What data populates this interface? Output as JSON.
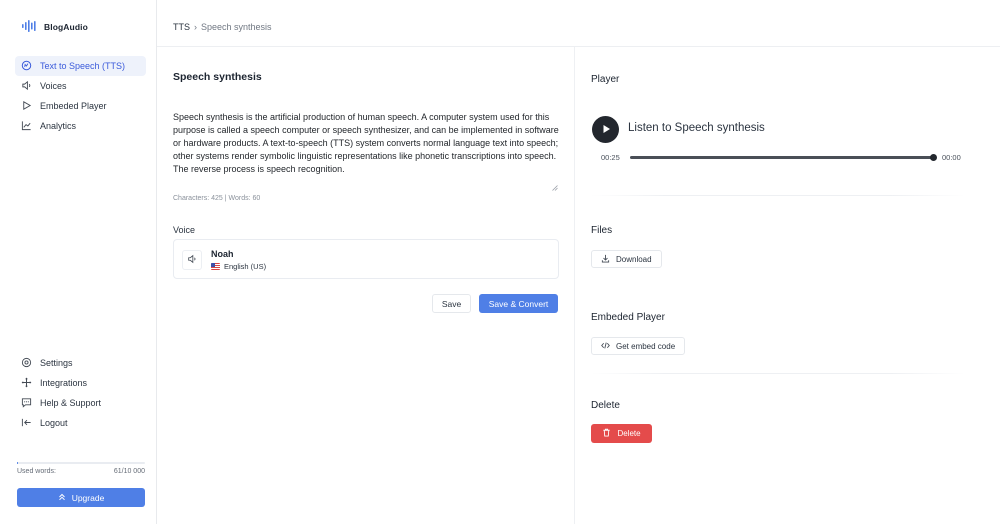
{
  "brand": {
    "name": "BlogAudio"
  },
  "sidebar": {
    "nav": [
      {
        "label": "Text to Speech (TTS)",
        "icon": "tts-icon",
        "active": true
      },
      {
        "label": "Voices",
        "icon": "speaker-icon"
      },
      {
        "label": "Embeded Player",
        "icon": "play-outline-icon"
      },
      {
        "label": "Analytics",
        "icon": "analytics-icon"
      }
    ],
    "bottom": [
      {
        "label": "Settings",
        "icon": "gear-icon"
      },
      {
        "label": "Integrations",
        "icon": "integrations-icon"
      },
      {
        "label": "Help & Support",
        "icon": "help-icon"
      },
      {
        "label": "Logout",
        "icon": "logout-icon"
      }
    ],
    "usage": {
      "label": "Used words:",
      "value": "61/10 000",
      "fraction": 0.0061
    },
    "upgrade_label": "Upgrade"
  },
  "header": {
    "breadcrumb_root": "TTS",
    "breadcrumb_sep": "›",
    "breadcrumb_current": "Speech synthesis"
  },
  "editor": {
    "title": "Speech synthesis",
    "text": "Speech synthesis is the artificial production of human speech. A computer system used for this purpose is called a speech computer or speech synthesizer, and can be implemented in software or hardware products. A text-to-speech (TTS) system converts normal language text into speech; other systems render symbolic linguistic representations like phonetic transcriptions into speech. The reverse process is speech recognition.",
    "counts": "Characters: 425 | Words: 60",
    "voice_label": "Voice",
    "voice": {
      "name": "Noah",
      "language": "English (US)"
    },
    "save_label": "Save",
    "convert_label": "Save & Convert"
  },
  "player": {
    "title": "Player",
    "listen_label": "Listen to Speech synthesis",
    "current_time": "00:25",
    "end_time": "00:00",
    "progress": 1.0
  },
  "files": {
    "title": "Files",
    "download_label": "Download"
  },
  "embed": {
    "title": "Embeded Player",
    "code_label": "Get embed code"
  },
  "delete": {
    "title": "Delete",
    "button_label": "Delete"
  },
  "colors": {
    "accent": "#4f7fe6",
    "danger": "#e44b4b",
    "dark": "#23272e"
  }
}
